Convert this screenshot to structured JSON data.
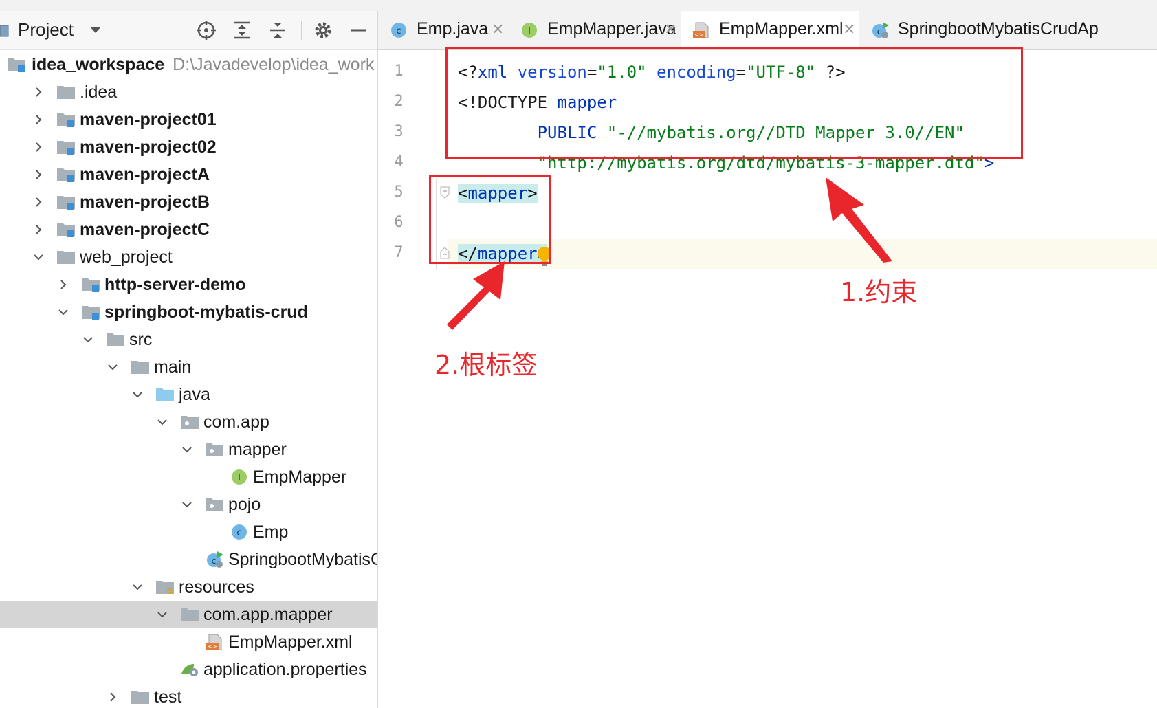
{
  "project_panel": {
    "title": "Project",
    "tree": [
      {
        "label": "idea_workspace",
        "path": "D:\\Javadevelop\\idea_work",
        "bold": true,
        "depth": 0,
        "arrow": "none",
        "icon": "module-folder-icon"
      },
      {
        "label": ".idea",
        "bold": false,
        "depth": 1,
        "arrow": "right",
        "icon": "folder-icon"
      },
      {
        "label": "maven-project01",
        "bold": true,
        "depth": 1,
        "arrow": "right",
        "icon": "module-folder-icon"
      },
      {
        "label": "maven-project02",
        "bold": true,
        "depth": 1,
        "arrow": "right",
        "icon": "module-folder-icon"
      },
      {
        "label": "maven-projectA",
        "bold": true,
        "depth": 1,
        "arrow": "right",
        "icon": "module-folder-icon"
      },
      {
        "label": "maven-projectB",
        "bold": true,
        "depth": 1,
        "arrow": "right",
        "icon": "module-folder-icon"
      },
      {
        "label": "maven-projectC",
        "bold": true,
        "depth": 1,
        "arrow": "right",
        "icon": "module-folder-icon"
      },
      {
        "label": "web_project",
        "bold": false,
        "depth": 1,
        "arrow": "down",
        "icon": "folder-icon"
      },
      {
        "label": "http-server-demo",
        "bold": true,
        "depth": 2,
        "arrow": "right",
        "icon": "module-folder-icon"
      },
      {
        "label": "springboot-mybatis-crud",
        "bold": true,
        "depth": 2,
        "arrow": "down",
        "icon": "module-folder-icon"
      },
      {
        "label": "src",
        "bold": false,
        "depth": 3,
        "arrow": "down",
        "icon": "folder-icon"
      },
      {
        "label": "main",
        "bold": false,
        "depth": 4,
        "arrow": "down",
        "icon": "folder-icon"
      },
      {
        "label": "java",
        "bold": false,
        "depth": 5,
        "arrow": "down",
        "icon": "source-folder-icon"
      },
      {
        "label": "com.app",
        "bold": false,
        "depth": 6,
        "arrow": "down",
        "icon": "package-icon"
      },
      {
        "label": "mapper",
        "bold": false,
        "depth": 7,
        "arrow": "down",
        "icon": "package-icon"
      },
      {
        "label": "EmpMapper",
        "bold": false,
        "depth": 8,
        "arrow": "none",
        "icon": "interface-icon"
      },
      {
        "label": "pojo",
        "bold": false,
        "depth": 7,
        "arrow": "down",
        "icon": "package-icon"
      },
      {
        "label": "Emp",
        "bold": false,
        "depth": 8,
        "arrow": "none",
        "icon": "class-icon"
      },
      {
        "label": "SpringbootMybatisCru",
        "bold": false,
        "depth": 7,
        "arrow": "none",
        "icon": "spring-app-icon"
      },
      {
        "label": "resources",
        "bold": false,
        "depth": 5,
        "arrow": "down",
        "icon": "resources-folder-icon"
      },
      {
        "label": "com.app.mapper",
        "bold": false,
        "depth": 6,
        "arrow": "down",
        "icon": "folder-icon",
        "selected": true
      },
      {
        "label": "EmpMapper.xml",
        "bold": false,
        "depth": 7,
        "arrow": "none",
        "icon": "xml-file-icon"
      },
      {
        "label": "application.properties",
        "bold": false,
        "depth": 6,
        "arrow": "none",
        "icon": "spring-properties-icon"
      },
      {
        "label": "test",
        "bold": false,
        "depth": 4,
        "arrow": "right",
        "icon": "folder-icon"
      }
    ]
  },
  "tabs": [
    {
      "label": "Emp.java",
      "icon": "class-icon",
      "active": false,
      "closable": true
    },
    {
      "label": "EmpMapper.java",
      "icon": "interface-icon",
      "active": false,
      "closable": true
    },
    {
      "label": "EmpMapper.xml",
      "icon": "xml-file-icon",
      "active": true,
      "closable": true
    },
    {
      "label": "SpringbootMybatisCrudAp",
      "icon": "spring-app-icon",
      "active": false,
      "closable": false
    }
  ],
  "editor": {
    "line_numbers": [
      "1",
      "2",
      "3",
      "4",
      "5",
      "6",
      "7"
    ],
    "code": {
      "l1_open": "<?",
      "l1_name": "xml",
      "l1_attr1": " version",
      "l1_eq1": "=",
      "l1_val1": "\"1.0\"",
      "l1_attr2": " encoding",
      "l1_eq2": "=",
      "l1_val2": "\"UTF-8\"",
      "l1_close": " ?>",
      "l2_open": "<!DOCTYPE",
      "l2_name": " mapper",
      "l3_indent": "        ",
      "l3_kw": "PUBLIC",
      "l3_str": " \"-//mybatis.org//DTD Mapper 3.0//EN\"",
      "l4_indent": "        ",
      "l4_str": "\"http://mybatis.org/dtd/mybatis-3-mapper.dtd\"",
      "l4_close": ">",
      "l5_open": "<",
      "l5_name": "mapper",
      "l5_close": ">",
      "l7_open": "</",
      "l7_name": "mapper",
      "l7_close": ">"
    }
  },
  "annotations": {
    "constraint_label": "1.约束",
    "root_tag_label": "2.根标签",
    "color": "#e8262b"
  }
}
